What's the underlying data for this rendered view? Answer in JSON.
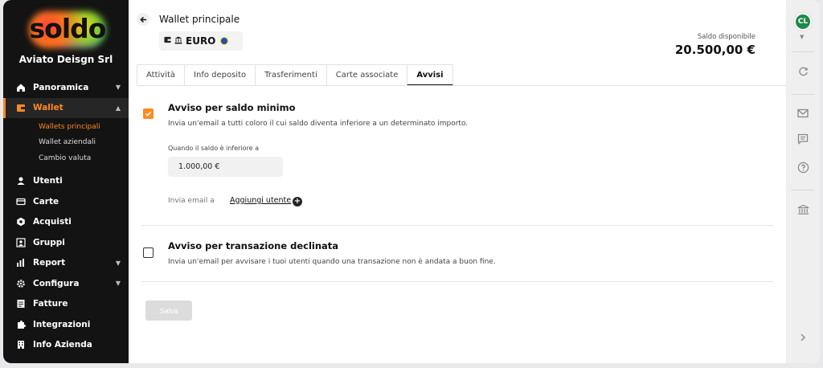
{
  "brand": {
    "logo_text": "soldo",
    "company": "Aviato Deisgn Srl"
  },
  "sidebar": {
    "items": [
      {
        "label": "Panoramica",
        "icon": "home-icon",
        "has_chevron": true
      },
      {
        "label": "Wallet",
        "icon": "wallet-icon",
        "has_chevron": true,
        "active": true,
        "children": [
          {
            "label": "Wallets principali",
            "active": true
          },
          {
            "label": "Wallet aziendali"
          },
          {
            "label": "Cambio valuta"
          }
        ]
      },
      {
        "label": "Utenti",
        "icon": "user-icon"
      },
      {
        "label": "Carte",
        "icon": "card-icon"
      },
      {
        "label": "Acquisti",
        "icon": "purchase-icon"
      },
      {
        "label": "Gruppi",
        "icon": "group-icon"
      },
      {
        "label": "Report",
        "icon": "chart-icon",
        "has_chevron": true
      },
      {
        "label": "Configura",
        "icon": "gear-icon",
        "has_chevron": true
      },
      {
        "label": "Fatture",
        "icon": "invoice-icon"
      },
      {
        "label": "Integrazioni",
        "icon": "puzzle-icon"
      },
      {
        "label": "Info Azienda",
        "icon": "building-icon"
      }
    ]
  },
  "header": {
    "title": "Wallet principale",
    "currency": "EURO",
    "balance_label": "Saldo disponibile",
    "balance_value": "20.500,00 €"
  },
  "tabs": [
    {
      "label": "Attività"
    },
    {
      "label": "Info deposito"
    },
    {
      "label": "Trasferimenti"
    },
    {
      "label": "Carte associate"
    },
    {
      "label": "Avvisi",
      "active": true
    }
  ],
  "alerts": {
    "min_balance": {
      "checked": true,
      "title": "Avviso per saldo minimo",
      "description": "Invia un'email a tutti coloro il cui saldo diventa inferiore a un determinato importo.",
      "threshold_label": "Quando il saldo è inferiore a",
      "threshold_value": "1.000,00 €",
      "send_email_label": "Invia email a",
      "add_user_label": "Aggiungi utente"
    },
    "declined_tx": {
      "checked": false,
      "title": "Avviso per transazione declinata",
      "description": "Invia un'email per avvisare i tuoi utenti quando una transazione non è andata a buon fine."
    }
  },
  "actions": {
    "save_label": "Salva"
  },
  "user": {
    "initials": "CL"
  },
  "colors": {
    "accent": "#ff8a1f",
    "sidebar_bg": "#131313",
    "avatar_bg": "#1d8a4a"
  }
}
